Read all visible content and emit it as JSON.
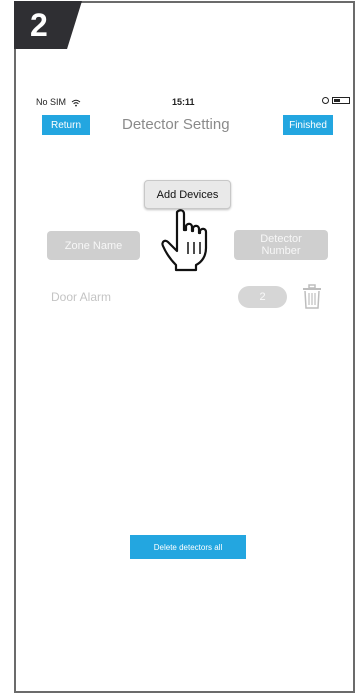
{
  "step_badge": "2",
  "status_bar": {
    "carrier": "No SIM",
    "time": "15:11"
  },
  "nav": {
    "return_label": "Return",
    "title": "Detector Setting",
    "finished_label": "Finished"
  },
  "add_devices_label": "Add Devices",
  "columns": {
    "zone_name": "Zone Name",
    "detector_number_line1": "Detector",
    "detector_number_line2": "Number"
  },
  "rows": [
    {
      "zone": "Door Alarm",
      "number": "2"
    }
  ],
  "delete_all_label": "Delete detectors all",
  "icons": {
    "wifi": "wifi-icon",
    "trash": "trash-icon",
    "hand": "pointing-hand-icon",
    "battery": "battery-icon",
    "lock": "rotation-lock-icon"
  },
  "colors": {
    "accent": "#23a6e0",
    "badge": "#2f2f33",
    "pill": "#cfcfcf"
  }
}
